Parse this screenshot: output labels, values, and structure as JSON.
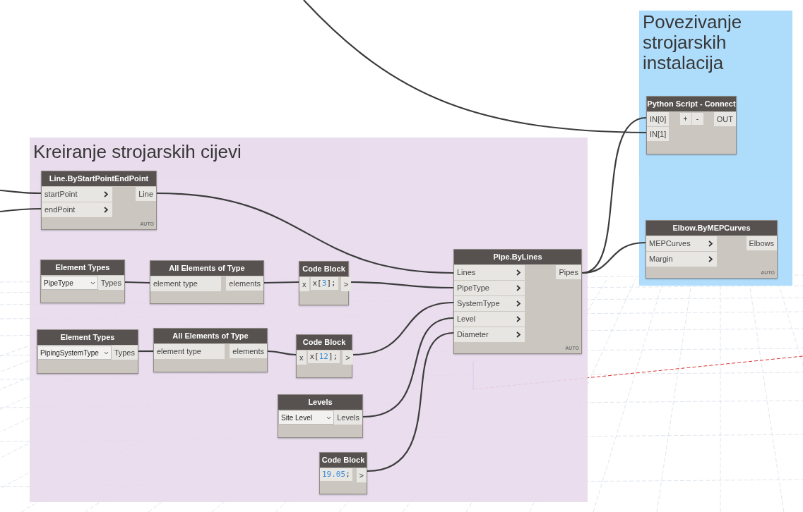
{
  "groups": [
    {
      "title": "Povezivanje strojarskih instalacija",
      "color": "#a6d9fb",
      "nodes": [
        {
          "kind": "python",
          "title": "Python Script - Connect",
          "inputs": [
            "IN[0]",
            "IN[1]"
          ],
          "buttons": [
            "+",
            "-"
          ],
          "outputs": [
            "OUT"
          ]
        },
        {
          "kind": "function",
          "title": "Elbow.ByMEPCurves",
          "inputs": [
            "MEPCurves",
            "Margin"
          ],
          "outputs": [
            "Elbows"
          ],
          "lacing": "AUTO"
        }
      ]
    },
    {
      "title": "Kreiranje strojarskih cijevi",
      "color": "#e7d9ec",
      "nodes": [
        {
          "kind": "function",
          "title": "Line.ByStartPointEndPoint",
          "inputs": [
            "startPoint",
            "endPoint"
          ],
          "outputs": [
            "Line"
          ],
          "lacing": "AUTO"
        },
        {
          "kind": "dropdown",
          "title": "Element Types",
          "value": "PipeType",
          "outputs": [
            "Types"
          ]
        },
        {
          "kind": "function",
          "title": "All Elements of Type",
          "inputs": [
            "element type"
          ],
          "outputs": [
            "elements"
          ]
        },
        {
          "kind": "code",
          "title": "Code Block",
          "inputs": [
            "x"
          ],
          "code": "x[3];",
          "outputs": [
            ">"
          ]
        },
        {
          "kind": "function",
          "title": "Pipe.ByLines",
          "inputs": [
            "Lines",
            "PipeType",
            "SystemType",
            "Level",
            "Diameter"
          ],
          "outputs": [
            "Pipes"
          ],
          "lacing": "AUTO"
        },
        {
          "kind": "dropdown",
          "title": "Element Types",
          "value": "PipingSystemType",
          "outputs": [
            "Types"
          ]
        },
        {
          "kind": "function",
          "title": "All Elements of Type",
          "inputs": [
            "element type"
          ],
          "outputs": [
            "elements"
          ]
        },
        {
          "kind": "code",
          "title": "Code Block",
          "inputs": [
            "x"
          ],
          "code": "x[12];",
          "outputs": [
            ">"
          ]
        },
        {
          "kind": "dropdown",
          "title": "Levels",
          "value": "Site Level",
          "outputs": [
            "Levels"
          ]
        },
        {
          "kind": "code",
          "title": "Code Block",
          "code": "19.05;",
          "outputs": [
            ">"
          ]
        }
      ]
    }
  ]
}
